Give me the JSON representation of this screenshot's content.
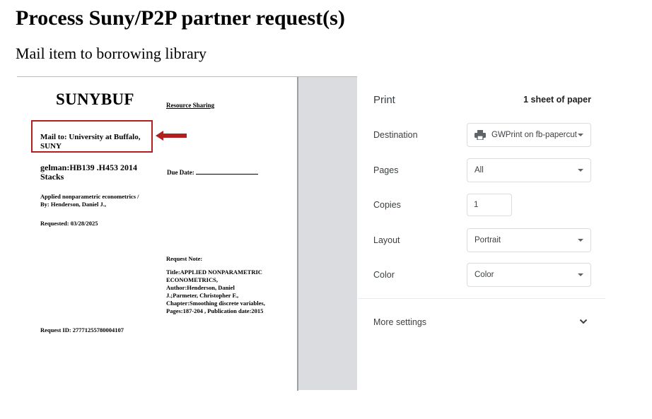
{
  "page": {
    "title": "Process Suny/P2P partner request(s)",
    "subtitle": "Mail item to borrowing library"
  },
  "slip": {
    "library": "SUNYBUF",
    "resource_sharing": "Resource Sharing",
    "mail_to": "Mail to: University at Buffalo, SUNY",
    "call_number": "gelman:HB139 .H453 2014 Stacks",
    "due_date_label": "Due Date:",
    "book_title": "Applied nonparametric econometrics /",
    "book_author": "By: Henderson, Daniel J.,",
    "requested": "Requested: 03/28/2025",
    "request_note_label": "Request Note:",
    "request_note_lines": [
      "Title:APPLIED NONPARAMETRIC",
      "ECONOMETRICS,",
      "Author:Henderson, Daniel",
      "J.;Parmeter, Christopher F.,",
      "Chapter:Smoothing discrete variables,",
      "Pages:187-204 , Publication date:2015"
    ],
    "request_id": "Request ID: 27771255780004107"
  },
  "print_dialog": {
    "header": "Print",
    "sheets": "1 sheet of paper",
    "destination_label": "Destination",
    "destination_value": "GWPrint on fb-papercut",
    "pages_label": "Pages",
    "pages_value": "All",
    "copies_label": "Copies",
    "copies_value": "1",
    "layout_label": "Layout",
    "layout_value": "Portrait",
    "color_label": "Color",
    "color_value": "Color",
    "more_settings": "More settings"
  },
  "colors": {
    "highlight": "#b11f1f",
    "preview_background": "#dadce0"
  },
  "icons": {
    "destination": "printer-icon",
    "dropdown": "caret-down-icon",
    "more_settings": "chevron-down-icon",
    "annotation": "red-arrow-icon"
  }
}
